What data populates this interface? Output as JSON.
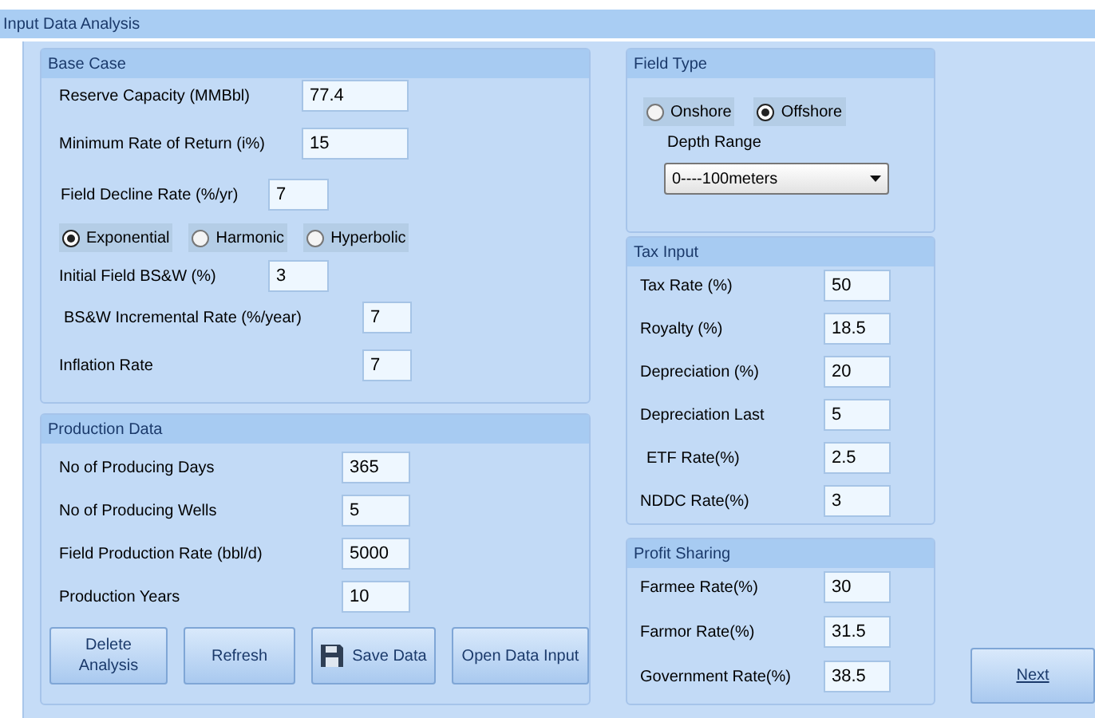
{
  "window": {
    "title": "Input Data Analysis"
  },
  "base_case": {
    "title": "Base Case",
    "fields": [
      {
        "label": "Reserve Capacity (MMBbl)",
        "value": "77.4"
      },
      {
        "label": "Minimum Rate of Return (i%)",
        "value": "15"
      },
      {
        "label": "Field Decline Rate (%/yr)",
        "value": "7"
      }
    ],
    "decline_models": [
      {
        "label": "Exponential",
        "selected": true
      },
      {
        "label": "Harmonic",
        "selected": false
      },
      {
        "label": "Hyperbolic",
        "selected": false
      }
    ],
    "fields_2": [
      {
        "label": "Initial Field BS&W (%)",
        "value": "3"
      },
      {
        "label": "BS&W Incremental Rate (%/year)",
        "value": "7"
      },
      {
        "label": "Inflation Rate",
        "value": "7"
      }
    ]
  },
  "production_data": {
    "title": "Production Data",
    "fields": [
      {
        "label": "No of Producing Days",
        "value": "365"
      },
      {
        "label": "No of Producing Wells",
        "value": "5"
      },
      {
        "label": "Field Production Rate (bbl/d)",
        "value": "5000"
      },
      {
        "label": "Production Years",
        "value": "10"
      }
    ],
    "buttons": [
      {
        "label": "Delete Analysis",
        "kind": "text"
      },
      {
        "label": "Refresh",
        "kind": "text"
      },
      {
        "label": "Save Data",
        "kind": "save"
      },
      {
        "label": "Open Data Input",
        "kind": "text"
      }
    ]
  },
  "field_type": {
    "title": "Field Type",
    "options": [
      {
        "label": "Onshore",
        "selected": false
      },
      {
        "label": "Offshore",
        "selected": true
      }
    ],
    "depth_label": "Depth Range",
    "depth_value": "0----100meters"
  },
  "tax_input": {
    "title": "Tax Input",
    "fields": [
      {
        "label": "Tax Rate (%)",
        "value": "50"
      },
      {
        "label": "Royalty (%)",
        "value": "18.5"
      },
      {
        "label": "Depreciation (%)",
        "value": "20"
      },
      {
        "label": "Depreciation Last",
        "value": "5"
      },
      {
        "label": "ETF Rate(%)",
        "value": "2.5"
      },
      {
        "label": "NDDC Rate(%)",
        "value": "3"
      }
    ]
  },
  "profit_sharing": {
    "title": "Profit Sharing",
    "fields": [
      {
        "label": "Farmee Rate(%)",
        "value": "30"
      },
      {
        "label": "Farmor Rate(%)",
        "value": "31.5"
      },
      {
        "label": "Government Rate(%)",
        "value": "38.5"
      }
    ]
  },
  "next_button": "Next"
}
